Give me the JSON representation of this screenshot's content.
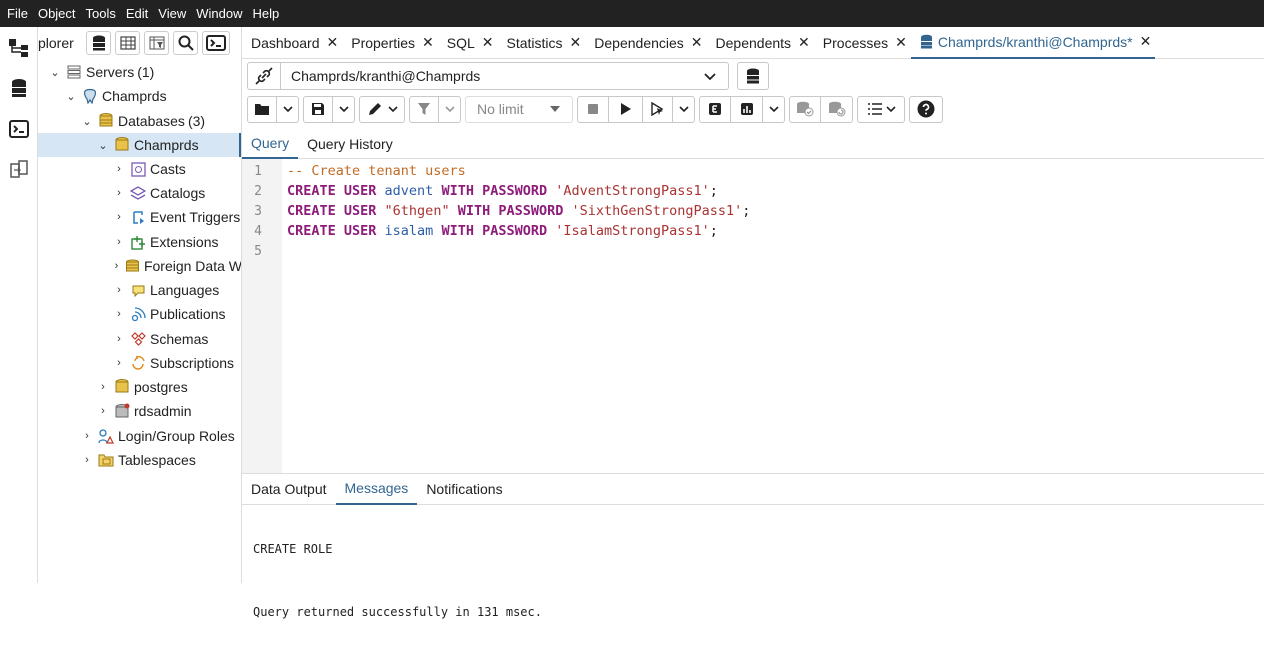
{
  "menu": [
    "File",
    "Object",
    "Tools",
    "Edit",
    "View",
    "Window",
    "Help"
  ],
  "explorer": {
    "title": "plorer"
  },
  "tree": [
    {
      "label": "Servers",
      "count": "(1)",
      "depth": 0,
      "chev": "v",
      "icon": "servers-icon"
    },
    {
      "label": "Champrds",
      "depth": 1,
      "chev": "v",
      "icon": "elephant-icon"
    },
    {
      "label": "Databases",
      "count": "(3)",
      "depth": 2,
      "chev": "v",
      "icon": "databases-icon"
    },
    {
      "label": "Champrds",
      "depth": 3,
      "chev": "v",
      "icon": "database-icon",
      "selected": true
    },
    {
      "label": "Casts",
      "depth": 4,
      "chev": ">",
      "icon": "casts-icon"
    },
    {
      "label": "Catalogs",
      "depth": 4,
      "chev": ">",
      "icon": "catalogs-icon"
    },
    {
      "label": "Event Triggers",
      "depth": 4,
      "chev": ">",
      "icon": "event-triggers-icon"
    },
    {
      "label": "Extensions",
      "depth": 4,
      "chev": ">",
      "icon": "extensions-icon"
    },
    {
      "label": "Foreign Data W",
      "depth": 4,
      "chev": ">",
      "icon": "foreign-data-icon"
    },
    {
      "label": "Languages",
      "depth": 4,
      "chev": ">",
      "icon": "languages-icon"
    },
    {
      "label": "Publications",
      "depth": 4,
      "chev": ">",
      "icon": "publications-icon"
    },
    {
      "label": "Schemas",
      "depth": 4,
      "chev": ">",
      "icon": "schemas-icon"
    },
    {
      "label": "Subscriptions",
      "depth": 4,
      "chev": ">",
      "icon": "subscriptions-icon"
    },
    {
      "label": "postgres",
      "depth": 3,
      "chev": ">",
      "icon": "database-icon"
    },
    {
      "label": "rdsadmin",
      "depth": 3,
      "chev": ">",
      "icon": "database-icon"
    },
    {
      "label": "Login/Group Roles",
      "depth": 2,
      "chev": ">",
      "icon": "roles-icon"
    },
    {
      "label": "Tablespaces",
      "depth": 2,
      "chev": ">",
      "icon": "tablespaces-icon"
    }
  ],
  "tabs": [
    {
      "label": "Dashboard"
    },
    {
      "label": "Properties"
    },
    {
      "label": "SQL"
    },
    {
      "label": "Statistics"
    },
    {
      "label": "Dependencies"
    },
    {
      "label": "Dependents"
    },
    {
      "label": "Processes"
    },
    {
      "label": "Champrds/kranthi@Champrds*",
      "active": true
    }
  ],
  "connection": {
    "value": "Champrds/kranthi@Champrds"
  },
  "toolbar": {
    "limit": "No limit"
  },
  "query_tabs": [
    {
      "label": "Query",
      "active": true
    },
    {
      "label": "Query History"
    }
  ],
  "editor": {
    "line_numbers": [
      "1",
      "2",
      "3",
      "4",
      "5"
    ],
    "comment": "-- Create tenant users",
    "lines": [
      {
        "k1": "CREATE USER",
        "name": "advent",
        "k2": "WITH PASSWORD",
        "pw": "'AdventStrongPass1'",
        "end": ";"
      },
      {
        "k1": "CREATE USER",
        "name": "\"6thgen\"",
        "k2": "WITH PASSWORD",
        "pw": "'SixthGenStrongPass1'",
        "end": ";"
      },
      {
        "k1": "CREATE USER",
        "name": "isalam",
        "k2": "WITH PASSWORD",
        "pw": "'IsalamStrongPass1'",
        "end": ";"
      }
    ]
  },
  "output_tabs": [
    {
      "label": "Data Output"
    },
    {
      "label": "Messages",
      "active": true
    },
    {
      "label": "Notifications"
    }
  ],
  "messages": {
    "line1": "CREATE ROLE",
    "line2": "Query returned successfully in 131 msec."
  },
  "colors": {
    "accent": "#326690",
    "selected": "#d6e6f5",
    "menubar": "#222222"
  }
}
